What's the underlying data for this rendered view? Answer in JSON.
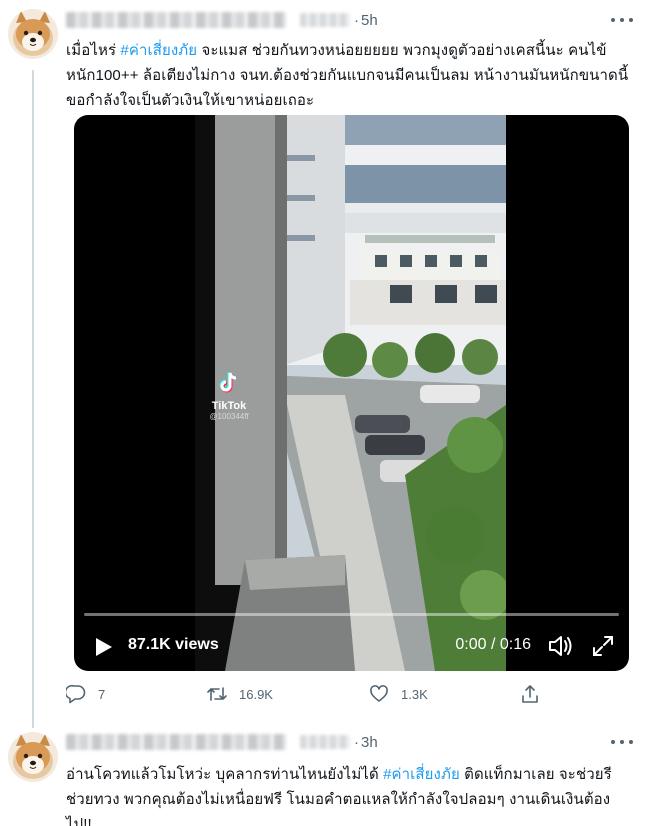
{
  "tweets": [
    {
      "time": "5h",
      "separator": "·",
      "text_parts": [
        "เมื่อไหร่ ",
        "#ค่าเสี่ยงภัย",
        " จะแมส ช่วยกันทวงหน่อยยยยย พวกมุงดูตัวอย่างเคสนี้นะ คนไข้หนัก100++ ล้อเตียงไม่กาง จนท.ต้องช่วยกันแบกจนมีคนเป็นลม หน้างานมันหนักขนาดนี้ ขอกำลังใจเป็นตัวเงินให้เขาหน่อยเถอะ"
      ],
      "video": {
        "views": "87.1K views",
        "time": "0:00 / 0:16",
        "progress": 0,
        "watermark_name": "TikTok",
        "watermark_user": "@100344ff"
      },
      "actions": {
        "replies": "7",
        "retweets": "16.9K",
        "likes": "1.3K"
      }
    },
    {
      "time": "3h",
      "separator": "·",
      "text_parts": [
        "อ่านโควทแล้วโมโหว่ะ บุคลากรท่านไหนยังไม่ได้ ",
        "#ค่าเสี่ยงภัย",
        " ติดแท็กมาเลย จะช่วยรี ช่วยทวง พวกคุณต้องไม่เหนื่อยฟรี โนมอคำตอแหลให้กำลังใจปลอมๆ งานเดินเงินต้องไป!!"
      ]
    }
  ],
  "colors": {
    "accent": "#1d9bf0",
    "text": "#0f1419",
    "muted": "#536471",
    "line": "#cfd9de"
  },
  "icons": [
    "shiba-avatar",
    "more-icon",
    "play-icon",
    "volume-icon",
    "fullscreen-icon",
    "tiktok-logo",
    "reply-icon",
    "retweet-icon",
    "like-icon",
    "share-icon"
  ]
}
